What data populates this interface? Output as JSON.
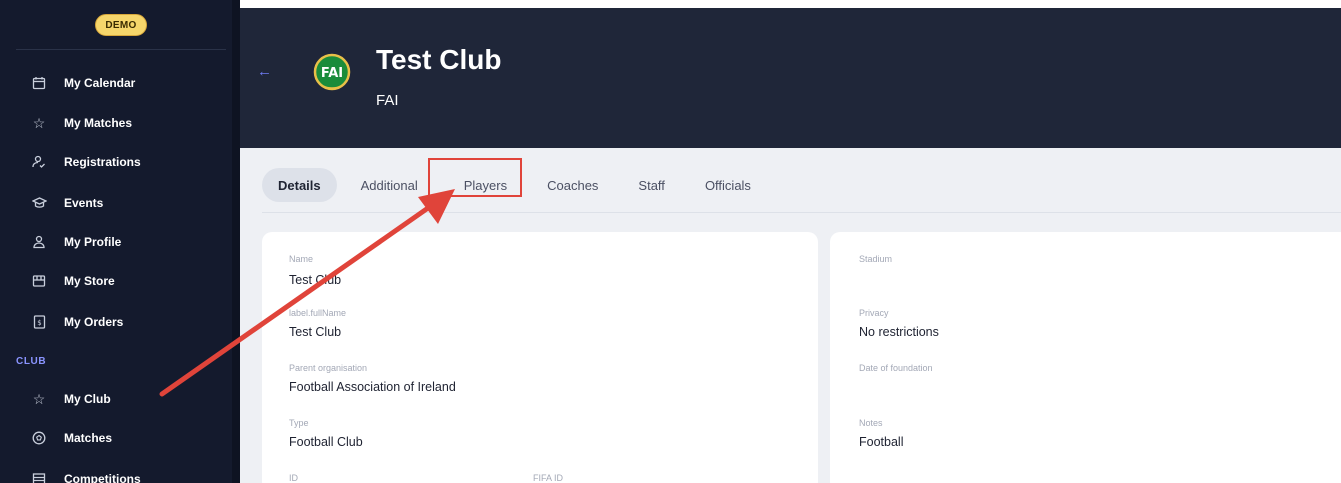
{
  "sidebar": {
    "badge": "DEMO",
    "items": [
      {
        "label": "My Calendar",
        "icon": "calendar-icon"
      },
      {
        "label": "My Matches",
        "icon": "star-icon"
      },
      {
        "label": "Registrations",
        "icon": "user-check-icon"
      },
      {
        "label": "Events",
        "icon": "graduation-cap-icon"
      },
      {
        "label": "My Profile",
        "icon": "user-icon"
      },
      {
        "label": "My Store",
        "icon": "store-icon"
      },
      {
        "label": "My Orders",
        "icon": "receipt-icon"
      }
    ],
    "section": "CLUB",
    "club_items": [
      {
        "label": "My Club",
        "icon": "star-icon"
      },
      {
        "label": "Matches",
        "icon": "soccer-ball-icon"
      },
      {
        "label": "Competitions",
        "icon": "list-icon"
      }
    ]
  },
  "header": {
    "title": "Test Club",
    "subtitle": "FAI",
    "logo_text": "FAI"
  },
  "tabs": [
    {
      "label": "Details",
      "active": true
    },
    {
      "label": "Additional"
    },
    {
      "label": "Players"
    },
    {
      "label": "Coaches"
    },
    {
      "label": "Staff"
    },
    {
      "label": "Officials"
    }
  ],
  "details_left": {
    "name_label": "Name",
    "name_value": "Test Club",
    "fullname_label": "label.fullName",
    "fullname_value": "Test Club",
    "parent_label": "Parent organisation",
    "parent_value": "Football Association of Ireland",
    "type_label": "Type",
    "type_value": "Football Club",
    "id_label": "ID",
    "fifa_label": "FIFA ID"
  },
  "details_right": {
    "stadium_label": "Stadium",
    "privacy_label": "Privacy",
    "privacy_value": "No restrictions",
    "foundation_label": "Date of foundation",
    "notes_label": "Notes",
    "notes_value": "Football"
  },
  "colors": {
    "sidebar": "#141a2d",
    "header": "#1f2639",
    "accent": "#6f7cf5",
    "annotation": "#e0443a"
  }
}
